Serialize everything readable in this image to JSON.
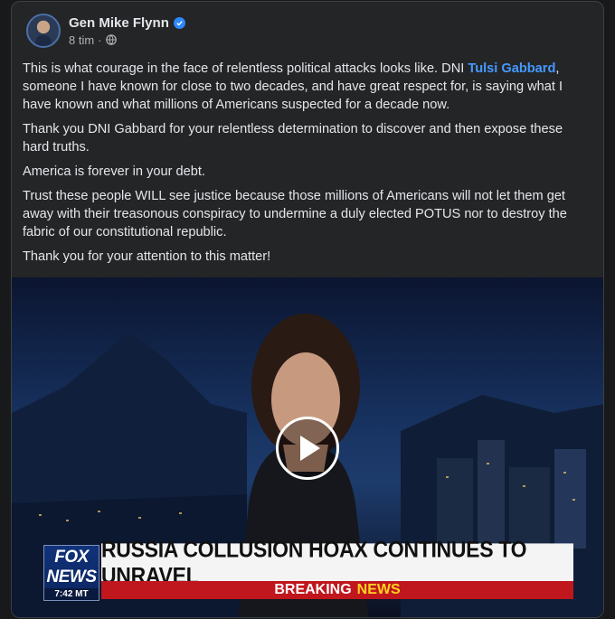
{
  "post": {
    "author": "Gen Mike Flynn",
    "time": "8 tim",
    "separator": "·",
    "privacy_icon": "globe-icon",
    "verified_icon": "verified-badge-icon",
    "paragraphs": {
      "p1_before": "This is what courage in the face of relentless political attacks looks like. DNI ",
      "p1_mention": "Tulsi Gabbard",
      "p1_after": ", someone I have known for close to two decades, and have great respect for, is saying what I have known and what millions of Americans suspected for a decade now.",
      "p2": "Thank you DNI Gabbard for your relentless determination to discover and then expose these hard truths.",
      "p3": "America is forever in your debt.",
      "p4": "Trust these people WILL see justice because those millions of Americans will not let them get away with their treasonous conspiracy to undermine a duly elected POTUS nor to destroy the fabric of our constitutional republic.",
      "p5": "Thank you for your attention to this matter!"
    }
  },
  "video": {
    "play_icon": "play-icon",
    "channel_logo_top": "FOX",
    "channel_logo_bottom": "NEWS",
    "channel_time": "7:42 MT",
    "headline": "RUSSIA COLLUSION HOAX CONTINUES TO UNRAVEL",
    "banner_first": "BREAKING",
    "banner_second": "NEWS"
  },
  "colors": {
    "background": "#18191a",
    "card": "#242526",
    "text": "#e4e6eb",
    "secondary_text": "#b0b3b8",
    "link": "#4599ff",
    "verified": "#2d88ff",
    "breaking_red": "#c0161d",
    "news_yellow": "#ffd21f"
  }
}
